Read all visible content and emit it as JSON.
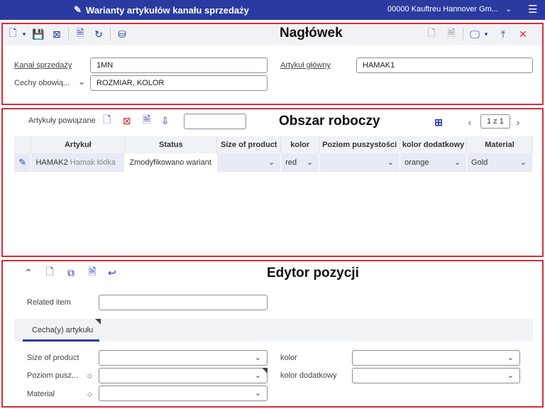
{
  "titlebar": {
    "title": "Warianty artykułów kanału sprzedaży",
    "company": "00000  Kauftreu Hannover Gm...",
    "menu_icon": "hamburger-icon"
  },
  "header": {
    "section_title": "Nagłówek",
    "sales_channel_label": "Kanał sprzedaży",
    "sales_channel_value": "1MN",
    "main_article_label": "Artykuł główny",
    "main_article_value": "HAMAK1",
    "mandatory_features_label": "Cechy obowią...",
    "mandatory_features_value": "ROZMIAR, KOLOR"
  },
  "workarea": {
    "section_title": "Obszar roboczy",
    "related_articles_label": "Artykuły powiązane",
    "pager_text": "1 z 1",
    "columns": [
      "Artykuł",
      "Status",
      "Size of product",
      "kolor",
      "Poziom puszystości",
      "kolor dodatkowy",
      "Material"
    ],
    "rows": [
      {
        "article_code": "HAMAK2",
        "article_name": "Hamak łódka",
        "status": "Zmodyfikowano wariant",
        "size": "",
        "kolor": "red",
        "poziom": "",
        "kolor_dodatkowy": "orange",
        "material": "Gold"
      }
    ]
  },
  "editor": {
    "section_title": "Edytor pozycji",
    "related_item_label": "Related item",
    "related_item_value": "",
    "tab_label": "Cecha(y) artykułu",
    "size_label": "Size of product",
    "kolor_label": "kolor",
    "poziom_label": "Poziom pusz...",
    "kolor_dodatkowy_label": "kolor dodatkowy",
    "material_label": "Material"
  },
  "colors": {
    "accent": "#2b3aa0",
    "highlight_border": "#d62d3a",
    "row_bg": "#e8eaf6"
  }
}
